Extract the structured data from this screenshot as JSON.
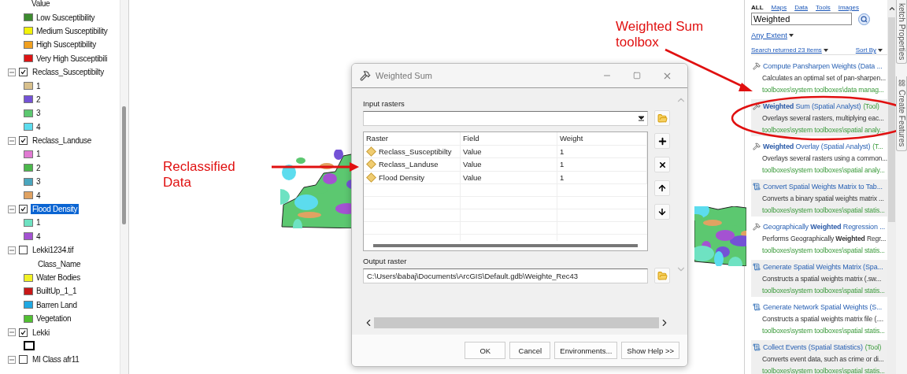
{
  "toc": {
    "legend": {
      "heading": "Value",
      "classes": [
        {
          "label": "Low Susceptibility",
          "color": "#3d8b2f"
        },
        {
          "label": "Medium Susceptibility",
          "color": "#f2f20a"
        },
        {
          "label": "High Susceptibility",
          "color": "#f0a020"
        },
        {
          "label": "Very High Susceptibili",
          "color": "#dd1414"
        }
      ]
    },
    "layers": [
      {
        "name": "Reclass_Susceptibilty",
        "checked": true,
        "expanded": true,
        "selected": false,
        "classes": [
          {
            "label": "1",
            "color": "#d8c08c",
            "kind": "fill"
          },
          {
            "label": "2",
            "color": "#7452d6",
            "kind": "fill"
          },
          {
            "label": "3",
            "color": "#5cc870",
            "kind": "fill"
          },
          {
            "label": "4",
            "color": "#5cdcee",
            "kind": "fill"
          }
        ]
      },
      {
        "name": "Reclass_Landuse",
        "checked": true,
        "expanded": true,
        "selected": false,
        "classes": [
          {
            "label": "1",
            "color": "#e07ad2",
            "kind": "fill"
          },
          {
            "label": "2",
            "color": "#4cb84c",
            "kind": "fill"
          },
          {
            "label": "3",
            "color": "#4aa6be",
            "kind": "fill"
          },
          {
            "label": "4",
            "color": "#e0a262",
            "kind": "fill"
          }
        ]
      },
      {
        "name": "Flood Density",
        "checked": true,
        "expanded": true,
        "selected": true,
        "classes": [
          {
            "label": "1",
            "color": "#6ee2c2",
            "kind": "fill"
          },
          {
            "label": "4",
            "color": "#a452d2",
            "kind": "fill"
          }
        ]
      },
      {
        "name": "Lekki1234.tif",
        "checked": false,
        "expanded": true,
        "selected": false,
        "heading": "Class_Name",
        "classes": [
          {
            "label": "Water Bodies",
            "color": "#f2f224",
            "kind": "fill"
          },
          {
            "label": "BuiltUp_1_1",
            "color": "#c81818",
            "kind": "fill"
          },
          {
            "label": "Barren Land",
            "color": "#20a8e2",
            "kind": "fill"
          },
          {
            "label": "Vegetation",
            "color": "#52c032",
            "kind": "fill"
          }
        ]
      },
      {
        "name": "Lekki",
        "checked": true,
        "expanded": true,
        "selected": false,
        "classes": [
          {
            "color": "#ffffff",
            "kind": "outline"
          }
        ]
      },
      {
        "name": "MI Class afr11",
        "checked": false,
        "expanded": true,
        "selected": false
      }
    ]
  },
  "annotations": [
    {
      "text": "Reclassified Data"
    },
    {
      "text": "Weighted Sum toolbox"
    }
  ],
  "dialog": {
    "title": "Weighted Sum",
    "input_rasters": {
      "label": "Input rasters"
    },
    "table": {
      "columns": [
        "Raster",
        "Field",
        "Weight"
      ],
      "rows": [
        {
          "raster": "Reclass_Susceptibilty",
          "field": "Value",
          "weight": "1"
        },
        {
          "raster": "Reclass_Landuse",
          "field": "Value",
          "weight": "1"
        },
        {
          "raster": "Flood Density",
          "field": "Value",
          "weight": "1"
        }
      ]
    },
    "output_raster": {
      "label": "Output raster",
      "value": "C:\\Users\\babaj\\Documents\\ArcGIS\\Default.gdb\\Weighte_Rec43"
    },
    "buttons": [
      "OK",
      "Cancel",
      "Environments...",
      "Show Help >>"
    ]
  },
  "search_panel": {
    "tabs": [
      {
        "label": "ALL",
        "selected": true
      },
      {
        "label": "Maps",
        "selected": false
      },
      {
        "label": "Data",
        "selected": false
      },
      {
        "label": "Tools",
        "selected": false
      },
      {
        "label": "Images",
        "selected": false
      }
    ],
    "query": "Weighted",
    "extent": "Any Extent",
    "summary": "Search returned 23 items",
    "sort": "Sort By",
    "results": [
      {
        "kind": "tool",
        "title": "Compute Pansharpen Weights (Data ...",
        "description": "Calculates an optimal set of pan-sharpen...",
        "path": "toolboxes\\system toolboxes\\data manag..."
      },
      {
        "kind": "tool",
        "title": "**Weighted** Sum (Spatial Analyst)",
        "suffix": "(Tool)",
        "description": "Overlays several rasters, multiplying eac...",
        "path": "toolboxes\\system toolboxes\\spatial analy..."
      },
      {
        "kind": "tool",
        "title": "**Weighted** Overlay (Spatial Analyst)",
        "suffix": "(T...",
        "description": "Overlays several rasters using a common...",
        "path": "toolboxes\\system toolboxes\\spatial analy..."
      },
      {
        "kind": "script",
        "title": "Convert Spatial Weights Matrix to Tab...",
        "description": "Converts a binary spatial weights matrix ...",
        "path": "toolboxes\\system toolboxes\\spatial statis..."
      },
      {
        "kind": "tool",
        "title": "Geographically **Weighted** Regression ...",
        "description": "Performs Geographically **Weighted** Regr...",
        "path": "toolboxes\\system toolboxes\\spatial statis..."
      },
      {
        "kind": "script",
        "title": "Generate Spatial Weights Matrix (Spa...",
        "description": "Constructs a spatial weights matrix (.sw...",
        "path": "toolboxes\\system toolboxes\\spatial statis..."
      },
      {
        "kind": "script",
        "title": "Generate Network Spatial Weights (S...",
        "description": "Constructs a spatial weights matrix file (....",
        "path": "toolboxes\\system toolboxes\\spatial statis..."
      },
      {
        "kind": "script",
        "title": "Collect Events (Spatial Statistics)",
        "suffix": "(Tool)",
        "description": "Converts event data, such as crime or di...",
        "path": "toolboxes\\system toolboxes\\spatial statis..."
      }
    ]
  },
  "side_tabs": [
    {
      "label": "ketch Properties",
      "kind": "plain"
    },
    {
      "label": "Create Features",
      "kind": "icon"
    }
  ]
}
